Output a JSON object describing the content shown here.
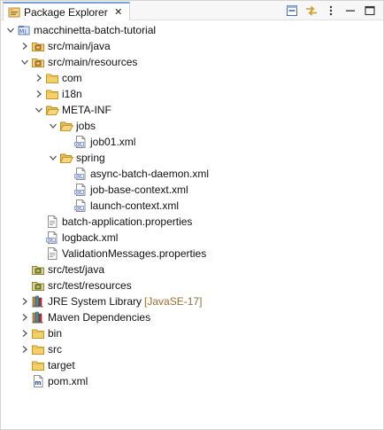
{
  "view": {
    "title": "Package Explorer",
    "close_glyph": "✕"
  },
  "toolbar": {
    "collapse_all": "collapse-all-icon",
    "link_with_editor": "link-with-editor-icon",
    "view_menu": "view-menu-icon",
    "minimize": "minimize-icon",
    "maximize": "maximize-icon"
  },
  "tree": [
    {
      "label": "macchinetta-batch-tutorial",
      "depth": 0,
      "expanded": true,
      "icon": "maven-project-icon"
    },
    {
      "label": "src/main/java",
      "depth": 1,
      "expanded": false,
      "icon": "source-folder-icon"
    },
    {
      "label": "src/main/resources",
      "depth": 1,
      "expanded": true,
      "icon": "source-folder-icon"
    },
    {
      "label": "com",
      "depth": 2,
      "expanded": false,
      "icon": "folder-icon"
    },
    {
      "label": "i18n",
      "depth": 2,
      "expanded": false,
      "icon": "folder-icon"
    },
    {
      "label": "META-INF",
      "depth": 2,
      "expanded": true,
      "icon": "folder-open-icon"
    },
    {
      "label": "jobs",
      "depth": 3,
      "expanded": true,
      "icon": "folder-open-icon"
    },
    {
      "label": "job01.xml",
      "depth": 4,
      "icon": "xml-file-icon"
    },
    {
      "label": "spring",
      "depth": 3,
      "expanded": true,
      "icon": "folder-open-icon"
    },
    {
      "label": "async-batch-daemon.xml",
      "depth": 4,
      "icon": "xml-file-icon"
    },
    {
      "label": "job-base-context.xml",
      "depth": 4,
      "icon": "xml-file-icon"
    },
    {
      "label": "launch-context.xml",
      "depth": 4,
      "icon": "xml-file-icon"
    },
    {
      "label": "batch-application.properties",
      "depth": 2,
      "icon": "properties-file-icon"
    },
    {
      "label": "logback.xml",
      "depth": 2,
      "icon": "xml-file-icon"
    },
    {
      "label": "ValidationMessages.properties",
      "depth": 2,
      "icon": "properties-file-icon"
    },
    {
      "label": "src/test/java",
      "depth": 1,
      "icon": "test-source-folder-icon"
    },
    {
      "label": "src/test/resources",
      "depth": 1,
      "icon": "test-source-folder-icon"
    },
    {
      "label": "JRE System Library",
      "decoration": "[JavaSE-17]",
      "depth": 1,
      "expanded": false,
      "icon": "library-icon"
    },
    {
      "label": "Maven Dependencies",
      "depth": 1,
      "expanded": false,
      "icon": "library-icon"
    },
    {
      "label": "bin",
      "depth": 1,
      "expanded": false,
      "icon": "folder-icon"
    },
    {
      "label": "src",
      "depth": 1,
      "expanded": false,
      "icon": "folder-icon"
    },
    {
      "label": "target",
      "depth": 1,
      "icon": "folder-icon"
    },
    {
      "label": "pom.xml",
      "depth": 1,
      "icon": "pom-file-icon"
    }
  ]
}
